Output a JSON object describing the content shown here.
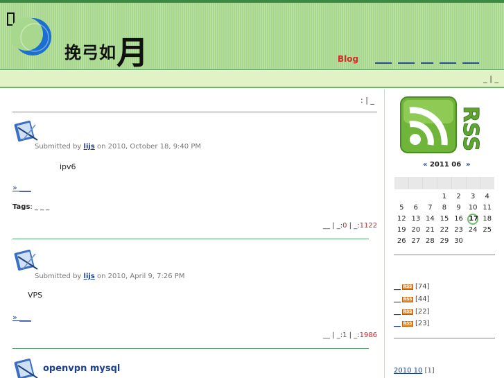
{
  "header": {
    "logo_text_small": "挽弓如",
    "logo_text_big": "月",
    "nav_blog": "Blog",
    "nav_items": [
      "____",
      "____",
      "___",
      "____",
      "____"
    ]
  },
  "subbar": {
    "right_text": "_ | _"
  },
  "main": {
    "top_links": ":   | _",
    "posts": [
      {
        "submitted_prefix": "Submitted by",
        "author": "lijs",
        "date": "on 2010, October 18, 9:40 PM",
        "body": "ipv6",
        "readmore": "» ___",
        "tags_label": "Tags",
        "tags_value": ": _ _ _",
        "stats_prefix": "__ | _:",
        "comments": "0",
        "stats_mid": "| _:",
        "reads": "1122"
      },
      {
        "submitted_prefix": "Submitted by",
        "author": "lijs",
        "date": "on 2010, April 9, 7:26 PM",
        "body": "VPS",
        "readmore": "» ___",
        "stats_prefix": "__ | _:",
        "comments": "1",
        "stats_mid": "| _:",
        "reads": "1986"
      },
      {
        "title": "openvpn    mysql"
      }
    ]
  },
  "sidebar": {
    "calendar": {
      "prev": "«",
      "month_label": "2011 06",
      "next": "»",
      "days": [
        "",
        "",
        "",
        "1",
        "2",
        "3",
        "4",
        "5",
        "6",
        "7",
        "8",
        "9",
        "10",
        "11",
        "12",
        "13",
        "14",
        "15",
        "16",
        "17",
        "18",
        "19",
        "20",
        "21",
        "22",
        "23",
        "24",
        "25",
        "26",
        "27",
        "28",
        "29",
        "30",
        "",
        ""
      ],
      "today": "17"
    },
    "feeds": [
      {
        "label": "__",
        "badge": "RSS",
        "count": "[74]"
      },
      {
        "label": "__",
        "badge": "RSS",
        "count": "[44]"
      },
      {
        "label": "__",
        "badge": "RSS",
        "count": "[22]"
      },
      {
        "label": "__",
        "badge": "RSS",
        "count": "[23]"
      }
    ],
    "archive": {
      "link": "2010 10",
      "count": "[1]"
    }
  },
  "colors": {
    "header_green": "#a7d88d",
    "accent_red": "#d32a2a",
    "link_blue": "#1e3f8a",
    "divider_green": "#5aa070"
  },
  "icons": {
    "missing_glyph": "missing-glyph-box",
    "logo": "crescent-moon-logo",
    "rss_logo": "rss-feed-icon",
    "post_icon": "blog-post-icon"
  }
}
